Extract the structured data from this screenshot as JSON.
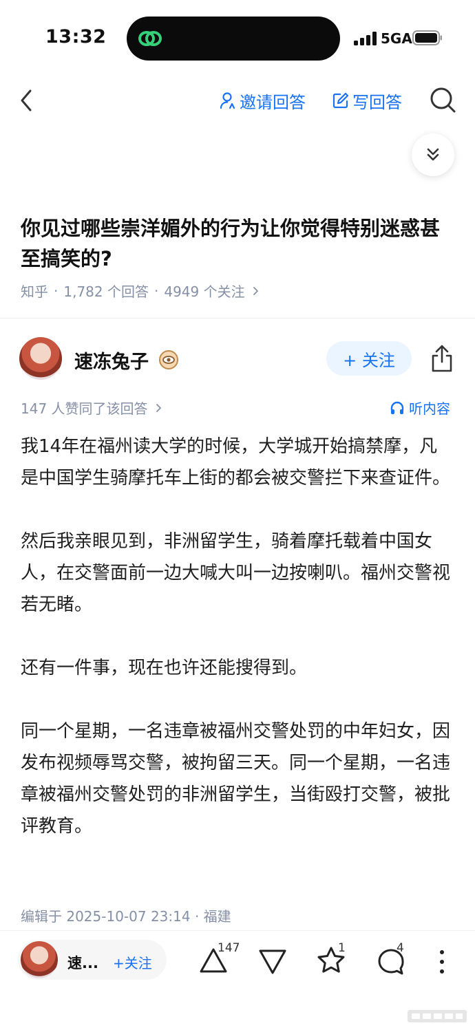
{
  "status_bar": {
    "time": "13:32",
    "network": "5GA"
  },
  "nav": {
    "invite_label": "邀请回答",
    "write_label": "写回答"
  },
  "question": {
    "title": "你见过哪些崇洋媚外的行为让你觉得特别迷惑甚至搞笑的?",
    "source": "知乎",
    "answers": "1,782 个回答",
    "follows": "4949 个关注",
    "separator": "·"
  },
  "author": {
    "name": "速冻兔子",
    "follow_label": "+ 关注"
  },
  "answer": {
    "likes_text": "147 人赞同了该回答",
    "listen_label": "听内容",
    "paragraphs": [
      "我14年在福州读大学的时候，大学城开始搞禁摩，凡是中国学生骑摩托车上街的都会被交警拦下来查证件。",
      "然后我亲眼见到，非洲留学生，骑着摩托载着中国女人，在交警面前一边大喊大叫一边按喇叭。福州交警视若无睹。",
      "还有一件事，现在也许还能搜得到。",
      "同一个星期，一名违章被福州交警处罚的中年妇女，因发布视频辱骂交警，被拘留三天。同一个星期，一名违章被福州交警处罚的非洲留学生，当街殴打交警，被批评教育。"
    ],
    "edit_info": "编辑于 2025-10-07 23:14 · 福建"
  },
  "bottom_bar": {
    "author_short": "速...",
    "follow_label": "+关注",
    "upvote_count": "147",
    "favorite_count": "1",
    "comment_count": "4"
  },
  "colors": {
    "accent": "#1772f6",
    "meta_gray": "#8590a6",
    "text": "#1f1f1f"
  }
}
